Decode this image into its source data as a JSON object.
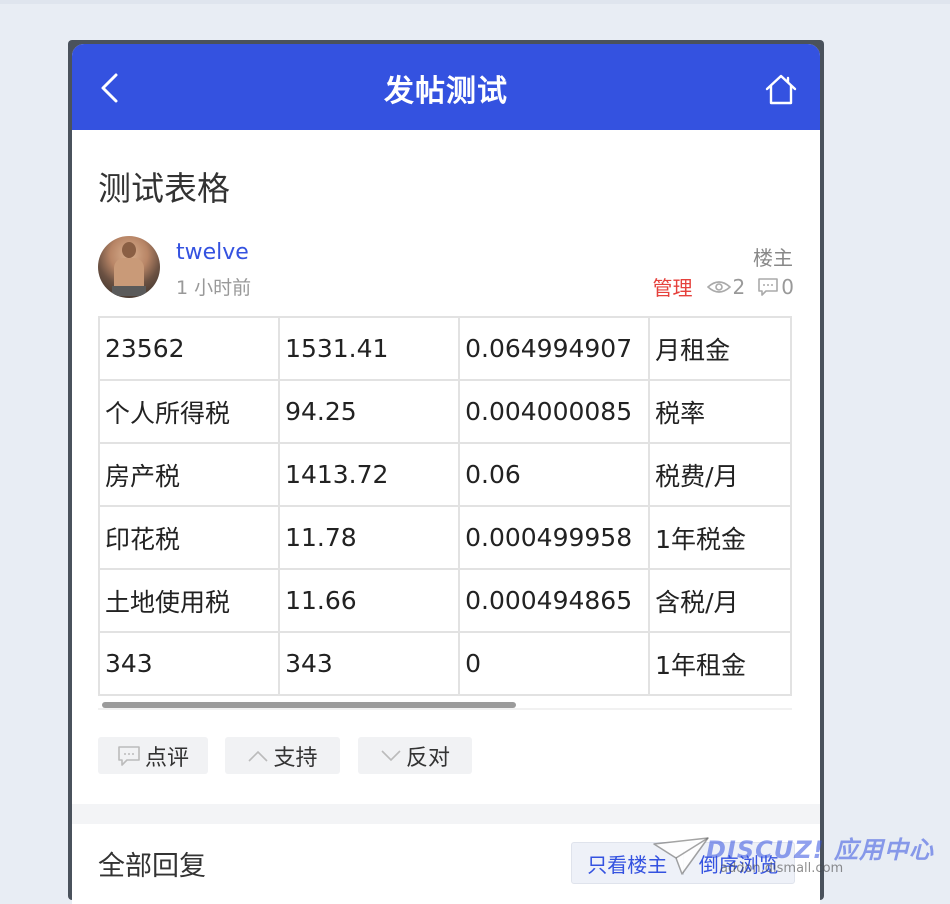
{
  "header": {
    "title": "发帖测试",
    "back_icon": "chevron-left-icon",
    "home_icon": "home-icon"
  },
  "post": {
    "title": "测试表格",
    "author": "twelve",
    "time": "1 小时前",
    "author_badge": "楼主",
    "admin_label": "管理",
    "views": "2",
    "comments": "0"
  },
  "table": {
    "rows": [
      [
        "23562",
        "1531.41",
        "0.064994907",
        "月租金"
      ],
      [
        "个人所得税",
        "94.25",
        "0.004000085",
        "税率"
      ],
      [
        "房产税",
        "1413.72",
        "0.06",
        "税费/月"
      ],
      [
        "印花税",
        "11.78",
        "0.000499958",
        "1年税金"
      ],
      [
        "土地使用税",
        "11.66",
        "0.000494865",
        "含税/月"
      ],
      [
        "343",
        "343",
        "0",
        "1年租金"
      ]
    ]
  },
  "actions": {
    "comment": "点评",
    "support": "支持",
    "oppose": "反对"
  },
  "replies": {
    "title": "全部回复",
    "author_only": "只看楼主",
    "reverse_order": "倒序浏览"
  },
  "watermark": {
    "logo": "DISCUZ! 应用中心",
    "site": "addon.dismall.com"
  },
  "colors": {
    "accent": "#3452e0",
    "admin": "#e5413c",
    "background": "#e8edf4"
  }
}
